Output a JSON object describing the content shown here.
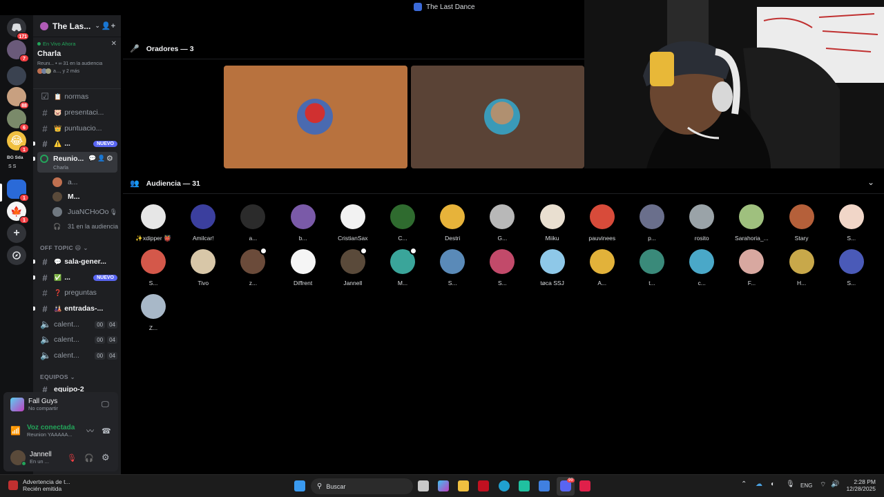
{
  "window_title": "The Last Dance",
  "server": {
    "name": "The Las...",
    "live_label": "En Vivo Ahora",
    "live_stage": "Charla",
    "live_meta": "Reuni... • ∞ 31 en la audiencia",
    "live_more": "a..., y 2 más"
  },
  "rail_badges": [
    "171",
    "7",
    "88",
    "6",
    "1",
    "1",
    "1"
  ],
  "rail_text": "BG  Sda",
  "channels": [
    {
      "label": "normas",
      "emoji": "📋"
    },
    {
      "label": "presentaci...",
      "emoji": "🐷"
    },
    {
      "label": "puntuacio...",
      "emoji": "👑"
    },
    {
      "label": "...",
      "emoji": "⚠️",
      "tag": "NUEVO"
    }
  ],
  "stage_channel": {
    "name": "Reunio...",
    "sub": "Charla"
  },
  "stage_members": [
    "a...",
    "M...",
    "JuaNCHoOo"
  ],
  "stage_audience": "31 en la audiencia",
  "off_topic": {
    "title": "OFF TOPIC 😆",
    "items": [
      {
        "label": "sala-gener...",
        "emoji": "💬"
      },
      {
        "label": "...",
        "emoji": "✅",
        "tag": "NUEVO"
      },
      {
        "label": "preguntas",
        "emoji": "❓"
      },
      {
        "label": "entradas-...",
        "emoji": "🎎"
      }
    ],
    "voice": [
      {
        "label": "calent...",
        "a": "00",
        "b": "04"
      },
      {
        "label": "calent...",
        "a": "00",
        "b": "04"
      },
      {
        "label": "calent...",
        "a": "00",
        "b": "04"
      }
    ]
  },
  "equipos": {
    "title": "EQUIPOS",
    "first": "equipo-2"
  },
  "activity": {
    "game": "Fall Guys",
    "sub": "No compartir"
  },
  "voice_status": {
    "title": "Voz conectada",
    "sub": "Reunion YAAAAA..."
  },
  "user": {
    "name": "Jannell",
    "status": "En un ..."
  },
  "speakers_header": "Oradores — 3",
  "audience_header": "Audiencia — 31",
  "audience": [
    {
      "name": "✨xdipper 👹",
      "color": "#e6e6e6"
    },
    {
      "name": "Amilcar!",
      "color": "#3b3f9e"
    },
    {
      "name": "a...",
      "color": "#2b2b2b"
    },
    {
      "name": "b...",
      "color": "#7a5aa8"
    },
    {
      "name": "CristianSax",
      "color": "#f2f2f2"
    },
    {
      "name": "C...",
      "color": "#2f6b2f"
    },
    {
      "name": "Destri",
      "color": "#e7b33a"
    },
    {
      "name": "G...",
      "color": "#b8b8b8"
    },
    {
      "name": "Miiku",
      "color": "#e9dfd0"
    },
    {
      "name": "pauvinees",
      "color": "#d84b3a"
    },
    {
      "name": "p...",
      "color": "#6a6f8c"
    },
    {
      "name": "rosito",
      "color": "#9aa3a8"
    },
    {
      "name": "Sarahoria_...",
      "color": "#9fc07e"
    },
    {
      "name": "Stary",
      "color": "#b5603a"
    },
    {
      "name": "S...",
      "color": "#f1d6c8"
    },
    {
      "name": "S...",
      "color": "#d4584a"
    },
    {
      "name": "Tivo",
      "color": "#d8c7a8"
    },
    {
      "name": "z...",
      "color": "#6b4b3a"
    },
    {
      "name": "Diffrent",
      "color": "#f5f5f5"
    },
    {
      "name": "Jannell",
      "color": "#5a4a3a"
    },
    {
      "name": "M...",
      "color": "#3aa59a"
    },
    {
      "name": "S...",
      "color": "#5a8ab8"
    },
    {
      "name": "S...",
      "color": "#c24a6a"
    },
    {
      "name": "tøca SSJ",
      "color": "#8ec8e8"
    },
    {
      "name": "A...",
      "color": "#e2b23a"
    },
    {
      "name": "t...",
      "color": "#3a8a7a"
    },
    {
      "name": "c...",
      "color": "#4aa8c8"
    },
    {
      "name": "F...",
      "color": "#d8a8a0"
    },
    {
      "name": "H...",
      "color": "#c8a84a"
    },
    {
      "name": "S...",
      "color": "#4a5ab8"
    },
    {
      "name": "Z...",
      "color": "#a8b8c8"
    }
  ],
  "taskbar": {
    "notif_title": "Advertencia de t...",
    "notif_sub": "Recién emitida",
    "search": "Buscar",
    "lang": "ENG",
    "time": "2:28 PM",
    "date": "12/28/2025",
    "discord_badge": "99"
  },
  "colors": {
    "accent": "#5865f2",
    "voice_green": "#23a55a",
    "danger": "#f23f43",
    "speaker_tile_1": "#b8723e",
    "speaker_tile_2": "#5a4336"
  }
}
